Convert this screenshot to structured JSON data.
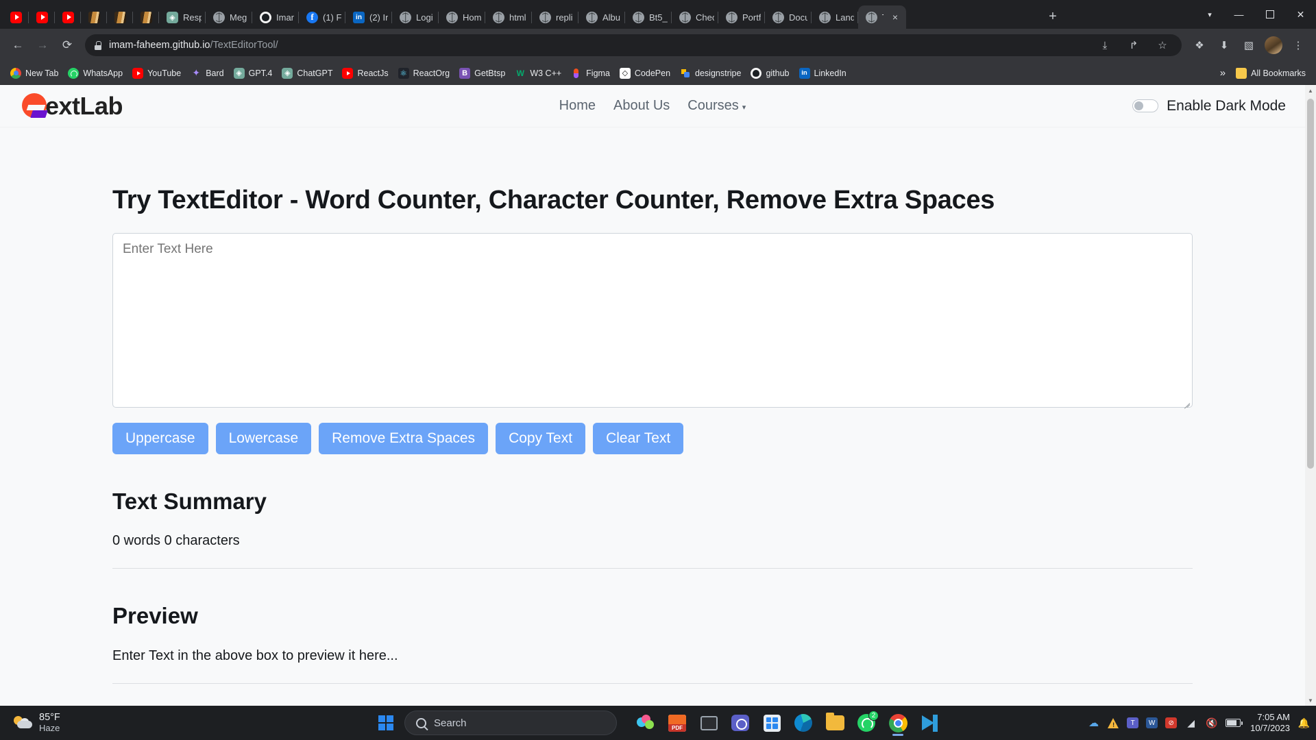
{
  "browser": {
    "tabs": [
      {
        "label": "",
        "icon": "youtube-icon",
        "active": false
      },
      {
        "label": "",
        "icon": "youtube-icon",
        "active": false
      },
      {
        "label": "",
        "icon": "youtube-icon",
        "active": false
      },
      {
        "label": "",
        "icon": "book-icon",
        "active": false
      },
      {
        "label": "",
        "icon": "book-icon",
        "active": false
      },
      {
        "label": "",
        "icon": "book-icon",
        "active": false
      },
      {
        "label": "Resp",
        "icon": "chatgpt-icon",
        "active": false
      },
      {
        "label": "Meg",
        "icon": "globe-icon",
        "active": false
      },
      {
        "label": "Imar",
        "icon": "github-icon",
        "active": false
      },
      {
        "label": "(1) F",
        "icon": "facebook-icon",
        "active": false
      },
      {
        "label": "(2) Ir",
        "icon": "linkedin-icon",
        "active": false
      },
      {
        "label": "Logi",
        "icon": "globe-icon",
        "active": false
      },
      {
        "label": "Hom",
        "icon": "globe-icon",
        "active": false
      },
      {
        "label": "html",
        "icon": "globe-icon",
        "active": false
      },
      {
        "label": "repli",
        "icon": "globe-icon",
        "active": false
      },
      {
        "label": "Albu",
        "icon": "globe-icon",
        "active": false
      },
      {
        "label": "Bt5_",
        "icon": "globe-icon",
        "active": false
      },
      {
        "label": "Chec",
        "icon": "globe-icon",
        "active": false
      },
      {
        "label": "Portf",
        "icon": "globe-icon",
        "active": false
      },
      {
        "label": "Docu",
        "icon": "globe-icon",
        "active": false
      },
      {
        "label": "Land",
        "icon": "globe-icon",
        "active": false
      },
      {
        "label": "T",
        "icon": "globe-icon",
        "active": true
      }
    ],
    "new_tab_glyph": "+",
    "tab_close_glyph": "×",
    "tab_list_chevron": "▾",
    "window_controls": {
      "minimize": "—",
      "maximize": "⬜",
      "close": "✕"
    },
    "toolbar": {
      "back_glyph": "←",
      "forward_glyph": "→",
      "reload_glyph": "⟳",
      "url_domain": "imam-faheem.github.io",
      "url_path": "/TextEditorTool/",
      "install_glyph": "⤓",
      "share_glyph": "↱",
      "bookmark_glyph": "☆",
      "extensions_glyph": "❖",
      "downloads_glyph": "⬇",
      "sidepanel_glyph": "▧",
      "menu_glyph": "⋮"
    },
    "bookmarks": [
      {
        "label": "New Tab",
        "icon": "chrome-icon"
      },
      {
        "label": "WhatsApp",
        "icon": "whatsapp-icon"
      },
      {
        "label": "YouTube",
        "icon": "youtube-icon"
      },
      {
        "label": "Bard",
        "icon": "bard-icon"
      },
      {
        "label": "GPT.4",
        "icon": "chatgpt-icon"
      },
      {
        "label": "ChatGPT",
        "icon": "chatgpt-icon"
      },
      {
        "label": "ReactJs",
        "icon": "youtube-icon"
      },
      {
        "label": "ReactOrg",
        "icon": "react-icon"
      },
      {
        "label": "GetBtsp",
        "icon": "bootstrap-icon"
      },
      {
        "label": "W3 C++",
        "icon": "w3schools-icon"
      },
      {
        "label": "Figma",
        "icon": "figma-icon"
      },
      {
        "label": "CodePen",
        "icon": "codepen-icon"
      },
      {
        "label": "designstripe",
        "icon": "designstripe-icon"
      },
      {
        "label": "github",
        "icon": "github-icon"
      },
      {
        "label": "LinkedIn",
        "icon": "linkedin-icon"
      }
    ],
    "bookmarks_overflow_glyph": "»",
    "all_bookmarks_label": "All Bookmarks"
  },
  "site": {
    "logo_text": "extLab",
    "nav": [
      {
        "label": "Home"
      },
      {
        "label": "About Us"
      },
      {
        "label": "Courses",
        "caret": "▾"
      }
    ],
    "dark_mode_label": "Enable Dark Mode",
    "dark_mode_on": false
  },
  "main": {
    "title": "Try TextEditor - Word Counter, Character Counter, Remove Extra Spaces",
    "textarea_value": "",
    "textarea_placeholder": "Enter Text Here",
    "buttons": [
      {
        "label": "Uppercase"
      },
      {
        "label": "Lowercase"
      },
      {
        "label": "Remove Extra Spaces"
      },
      {
        "label": "Copy Text"
      },
      {
        "label": "Clear Text"
      }
    ],
    "summary_heading": "Text Summary",
    "summary_stats": "0 words 0 characters",
    "preview_heading": "Preview",
    "preview_text": "Enter Text in the above box to preview it here..."
  },
  "colors": {
    "button_blue": "#6ba4f8",
    "logo_orange": "#fa4b2a",
    "logo_purple": "#6a12cf",
    "page_bg": "#f8f9fa"
  },
  "taskbar": {
    "weather_temp": "85°F",
    "weather_condition": "Haze",
    "search_placeholder": "Search",
    "apps": [
      {
        "name": "paint-3d",
        "badge": ""
      },
      {
        "name": "pdf-reader",
        "badge": ""
      },
      {
        "name": "task-view",
        "badge": ""
      },
      {
        "name": "teams",
        "badge": ""
      },
      {
        "name": "microsoft-store",
        "badge": ""
      },
      {
        "name": "microsoft-edge",
        "badge": ""
      },
      {
        "name": "file-explorer",
        "badge": ""
      },
      {
        "name": "whatsapp",
        "badge": "2"
      },
      {
        "name": "google-chrome",
        "badge": ""
      },
      {
        "name": "vs-code",
        "badge": ""
      }
    ],
    "tray": [
      {
        "name": "onedrive-icon",
        "glyph": "☁"
      },
      {
        "name": "warning-icon",
        "glyph": ""
      },
      {
        "name": "teams-tray-icon",
        "glyph": "T"
      },
      {
        "name": "word-tray-icon",
        "glyph": "W"
      },
      {
        "name": "no-entry-icon",
        "glyph": "⛔"
      },
      {
        "name": "wifi-icon",
        "glyph": "◠"
      },
      {
        "name": "volume-mute-icon",
        "glyph": "🔇"
      },
      {
        "name": "battery-icon",
        "glyph": ""
      }
    ],
    "time": "7:05 AM",
    "date": "10/7/2023",
    "notification_glyph": "🔔"
  }
}
